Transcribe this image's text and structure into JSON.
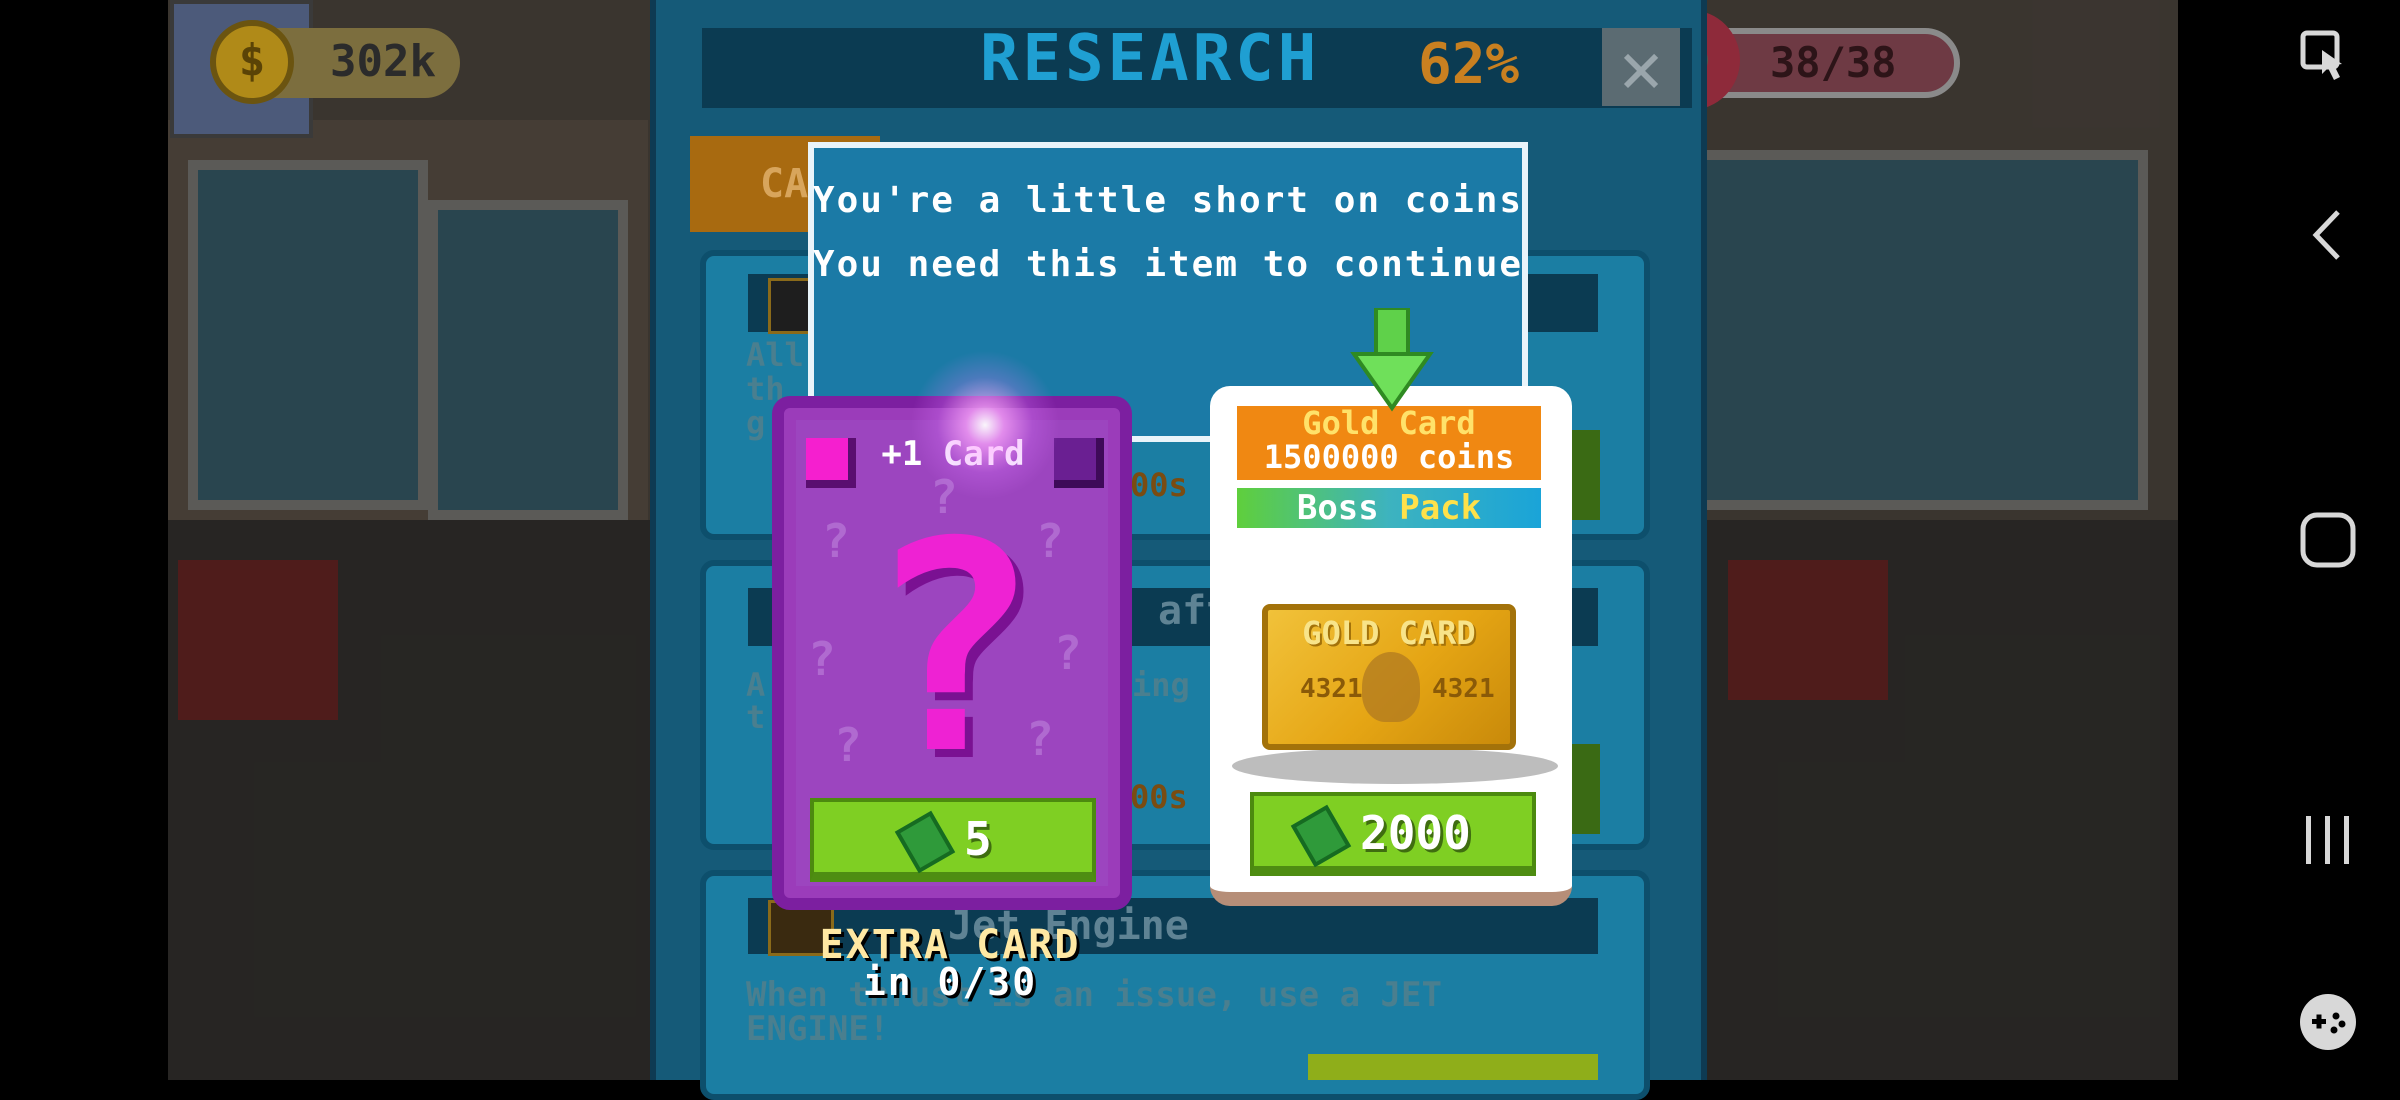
{
  "hud": {
    "coins": "302k",
    "coin_symbol": "$",
    "lives": "38/38"
  },
  "research": {
    "title": "RESEARCH",
    "progress_percent": "62%",
    "progress_value": 0.62,
    "close_symbol": "✕",
    "tab_label": "CA",
    "items": [
      {
        "title": "",
        "desc_lines": [
          "All",
          "th",
          "g"
        ],
        "time": "00s"
      },
      {
        "title": "aft",
        "desc_lines": [
          "A",
          "t"
        ],
        "extra": "ing",
        "time": "00s"
      },
      {
        "title": "Jet Engine",
        "desc_lines": [
          "When thrust is an issue, use a JET",
          "ENGINE!"
        ]
      }
    ]
  },
  "dialog": {
    "line1": "You're a little short on coins",
    "line2": "You need this item to continue"
  },
  "offer_left": {
    "title": "+1 Card",
    "price": "5",
    "price_icon": "cash-icon",
    "footer_line1": "EXTRA CARD",
    "footer_line2": "in 0/30"
  },
  "offer_right": {
    "header_line1": "Gold Card",
    "header_line2": "1500000 coins",
    "pack_word1": "Boss",
    "pack_word2": "Pack",
    "card_title": "GOLD CARD",
    "card_num_left": "4321",
    "card_num_right": "4321",
    "price": "2000",
    "price_icon": "cash-icon"
  },
  "colors": {
    "panel": "#155a78",
    "purple_card": "#9b3cba",
    "green_button": "#7fcf23",
    "gold_header": "#f08812"
  },
  "nav": {
    "icons": [
      "screenshot-tool-icon",
      "back-icon",
      "home-icon",
      "recents-icon",
      "game-tools-icon"
    ]
  }
}
